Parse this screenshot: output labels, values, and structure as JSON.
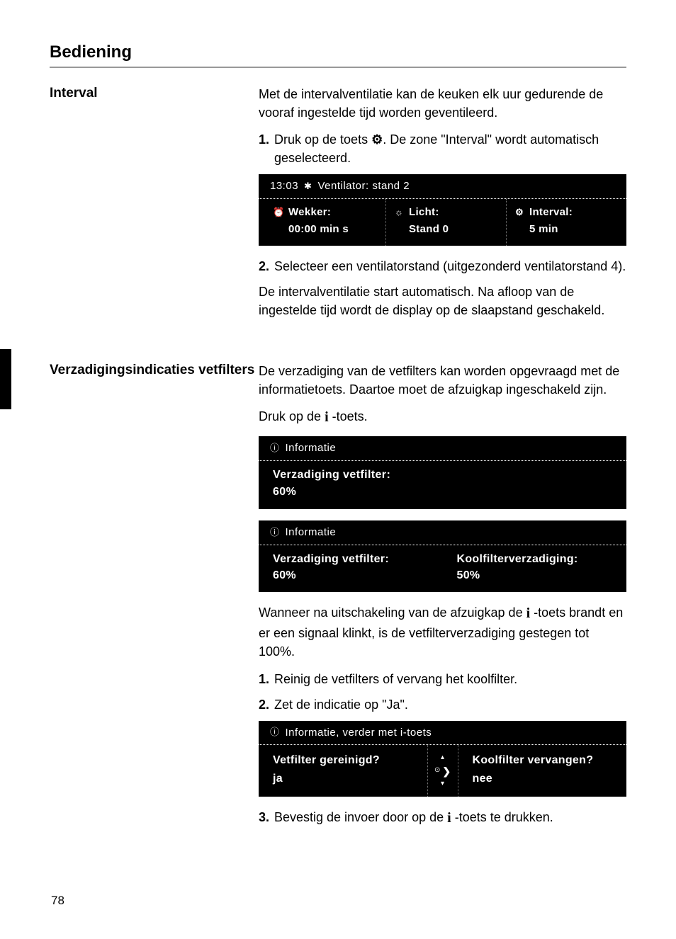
{
  "page": {
    "number": "78",
    "title": "Bediening"
  },
  "sections": [
    {
      "heading": "Interval",
      "intro": "Met de intervalventilatie kan de keuken elk uur gedurende de vooraf ingestelde tijd worden geventileerd.",
      "step1_num": "1.",
      "step1_a": "Druk op de toets ",
      "step1_icon": "⚙",
      "step1_b": ". De zone \"Interval\" wordt automatisch geselecteerd.",
      "display1": {
        "time": "13:03",
        "hdr_icon": "✱",
        "hdr_text": "Ventilator: stand 2",
        "col1_icon": "⏰",
        "col1_title": "Wekker:",
        "col1_value": "00:00 min s",
        "col2_icon": "☼",
        "col2_title": "Licht:",
        "col2_value": "Stand 0",
        "col3_icon": "⚙",
        "col3_title": "Interval:",
        "col3_value": "5   min"
      },
      "step2_num": "2.",
      "step2_text": "Selecteer een ventilatorstand (uitgezonderd ventilatorstand 4).",
      "outro": "De intervalventilatie start automatisch. Na afloop van de ingestelde tijd wordt de display op de slaapstand geschakeld."
    },
    {
      "heading": "Verzadigingsindicaties vetfilters",
      "intro": "De verzadiging van de vetfilters kan worden opgevraagd met de informatietoets. Daartoe moet de afzuigkap ingeschakeld zijn.",
      "press_a": "Druk op de ",
      "press_i": "i",
      "press_b": " -toets.",
      "display2": {
        "hdr_icon": "ⓘ",
        "hdr_text": "Informatie",
        "line1": "Verzadiging vetfilter:",
        "line2": "60%"
      },
      "display3": {
        "hdr_icon": "ⓘ",
        "hdr_text": "Informatie",
        "l_line1": "Verzadiging vetfilter:",
        "l_line2": "60%",
        "r_line1": "Koolfilterverzadiging:",
        "r_line2": "50%"
      },
      "warn_a": "Wanneer na uitschakeling van de afzuigkap de ",
      "warn_i": "i",
      "warn_b": " -toets brandt en er een signaal klinkt, is de vetfilterverzadiging gestegen tot 100%.",
      "step1_num": "1.",
      "step1_text": "Reinig de vetfilters of vervang het koolfilter.",
      "step2_num": "2.",
      "step2_text": "Zet de indicatie op \"Ja\".",
      "display4": {
        "hdr_icon": "ⓘ",
        "hdr_text": "Informatie, verder met i-toets",
        "l_q": "Vetfilter gereinigd?",
        "l_a": "ja",
        "mid_up": "▴",
        "mid_center": "⊙",
        "mid_right": "❯",
        "mid_down": "▾",
        "r_q": "Koolfilter vervangen?",
        "r_a": "nee"
      },
      "step3_num": "3.",
      "step3_a": "Bevestig de invoer door op de ",
      "step3_i": "i",
      "step3_b": " -toets te drukken."
    }
  ]
}
